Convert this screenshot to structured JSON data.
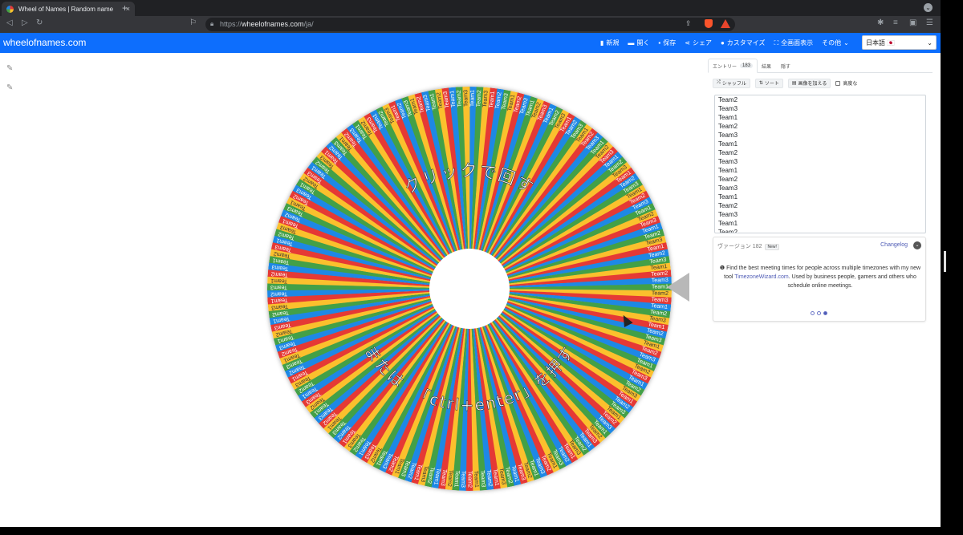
{
  "browser": {
    "tab_title": "Wheel of Names | Random name",
    "tab_close": "×",
    "new_tab": "+",
    "url_prefix": "https://",
    "url_host": "wheelofnames.com",
    "url_path": "/ja/",
    "icons": [
      "back-icon",
      "forward-icon",
      "reload-icon",
      "bookmark-icon",
      "lock-icon",
      "share-icon",
      "brave-shields-icon",
      "brave-rewards-icon",
      "extensions-icon",
      "playlist-icon",
      "wallet-icon",
      "menu-icon"
    ]
  },
  "app": {
    "brand": "wheelofnames.com",
    "menu": [
      {
        "icon": "file-icon",
        "label": "新規"
      },
      {
        "icon": "folder-icon",
        "label": "開く"
      },
      {
        "icon": "save-icon",
        "label": "保存"
      },
      {
        "icon": "share-icon",
        "label": "シェア"
      },
      {
        "icon": "palette-icon",
        "label": "カスタマイズ"
      },
      {
        "icon": "fullscreen-icon",
        "label": "全画面表示"
      },
      {
        "icon": "",
        "label": "その他"
      }
    ],
    "language": "日本語 🇯🇵"
  },
  "wheel": {
    "top_text": "クリックで回す",
    "bottom_text": "またはﾠ「ctrl+enter」を押す",
    "segment_colors": [
      "#1e88e5",
      "#43a047",
      "#fbc02d",
      "#e53935"
    ],
    "segment_labels": [
      "Team1",
      "Team2",
      "Team3"
    ],
    "entry_count": 183
  },
  "panel": {
    "tabs": [
      {
        "label": "エントリー",
        "badge": "183"
      },
      {
        "label": "結果"
      },
      {
        "label": "隠す"
      }
    ],
    "buttons": [
      {
        "icon": "shuffle-icon",
        "label": "シャッフル"
      },
      {
        "icon": "sort-icon",
        "label": "ソート"
      },
      {
        "icon": "image-icon",
        "label": "画像を加える"
      }
    ],
    "advanced_label": "高度な",
    "entries": [
      "Team2",
      "Team3",
      "Team1",
      "Team2",
      "Team3",
      "Team1",
      "Team2",
      "Team3",
      "Team1",
      "Team2",
      "Team3",
      "Team1",
      "Team2",
      "Team3",
      "Team1",
      "Team2"
    ],
    "version_text": "ヴァージョン 182",
    "new_badge": "New!",
    "changelog": "Changelog",
    "news_pre": "Find the best meeting times for people across multiple timezones with my new tool ",
    "news_link": "TimezoneWizard.com",
    "news_post": ". Used by business people, gamers and others who schedule online meetings."
  }
}
